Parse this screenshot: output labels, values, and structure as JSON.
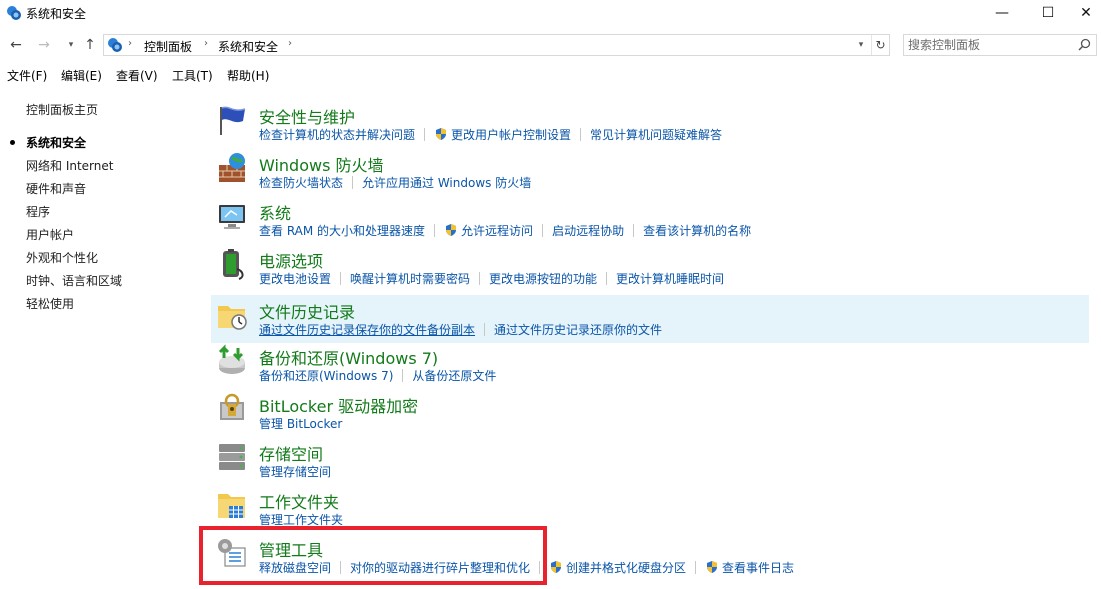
{
  "window": {
    "title": "系统和安全",
    "controls": {
      "minimize": "—",
      "maximize": "☐",
      "close": "✕"
    }
  },
  "address": {
    "crumbs": [
      "控制面板",
      "系统和安全"
    ],
    "search_placeholder": "搜索控制面板"
  },
  "menu": [
    "文件(F)",
    "编辑(E)",
    "查看(V)",
    "工具(T)",
    "帮助(H)"
  ],
  "sidebar": {
    "home": "控制面板主页",
    "items": [
      "系统和安全",
      "网络和 Internet",
      "硬件和声音",
      "程序",
      "用户帐户",
      "外观和个性化",
      "时钟、语言和区域",
      "轻松使用"
    ],
    "current_index": 0
  },
  "categories": [
    {
      "title": "安全性与维护",
      "icon": "flag-icon",
      "links": [
        {
          "text": "检查计算机的状态并解决问题"
        },
        {
          "text": "更改用户帐户控制设置",
          "shield": true
        },
        {
          "text": "常见计算机问题疑难解答"
        }
      ]
    },
    {
      "title": "Windows 防火墙",
      "icon": "firewall-icon",
      "links": [
        {
          "text": "检查防火墙状态"
        },
        {
          "text": "允许应用通过 Windows 防火墙"
        }
      ]
    },
    {
      "title": "系统",
      "icon": "computer-icon",
      "links": [
        {
          "text": "查看 RAM 的大小和处理器速度"
        },
        {
          "text": "允许远程访问",
          "shield": true
        },
        {
          "text": "启动远程协助"
        },
        {
          "text": "查看该计算机的名称"
        }
      ]
    },
    {
      "title": "电源选项",
      "icon": "battery-icon",
      "links": [
        {
          "text": "更改电池设置"
        },
        {
          "text": "唤醒计算机时需要密码"
        },
        {
          "text": "更改电源按钮的功能"
        },
        {
          "text": "更改计算机睡眠时间"
        }
      ]
    },
    {
      "title": "文件历史记录",
      "icon": "file-history-icon",
      "highlight": true,
      "links": [
        {
          "text": "通过文件历史记录保存你的文件备份副本",
          "underline": true
        },
        {
          "text": "通过文件历史记录还原你的文件"
        }
      ]
    },
    {
      "title": "备份和还原(Windows 7)",
      "icon": "backup-icon",
      "links": [
        {
          "text": "备份和还原(Windows 7)"
        },
        {
          "text": "从备份还原文件"
        }
      ]
    },
    {
      "title": "BitLocker 驱动器加密",
      "icon": "bitlocker-icon",
      "links": [
        {
          "text": "管理 BitLocker"
        }
      ]
    },
    {
      "title": "存储空间",
      "icon": "storage-icon",
      "links": [
        {
          "text": "管理存储空间"
        }
      ]
    },
    {
      "title": "工作文件夹",
      "icon": "work-folders-icon",
      "links": [
        {
          "text": "管理工作文件夹"
        }
      ]
    },
    {
      "title": "管理工具",
      "icon": "admin-tools-icon",
      "links": [
        {
          "text": "释放磁盘空间"
        },
        {
          "text": "对你的驱动器进行碎片整理和优化"
        },
        {
          "text": "创建并格式化硬盘分区",
          "shield": true
        },
        {
          "text": "查看事件日志",
          "shield": true
        }
      ]
    }
  ],
  "colors": {
    "category_title": "#137a1a",
    "link": "#0a55a8",
    "highlight": "#e5f3fb",
    "annotation_box": "#e8232e"
  }
}
